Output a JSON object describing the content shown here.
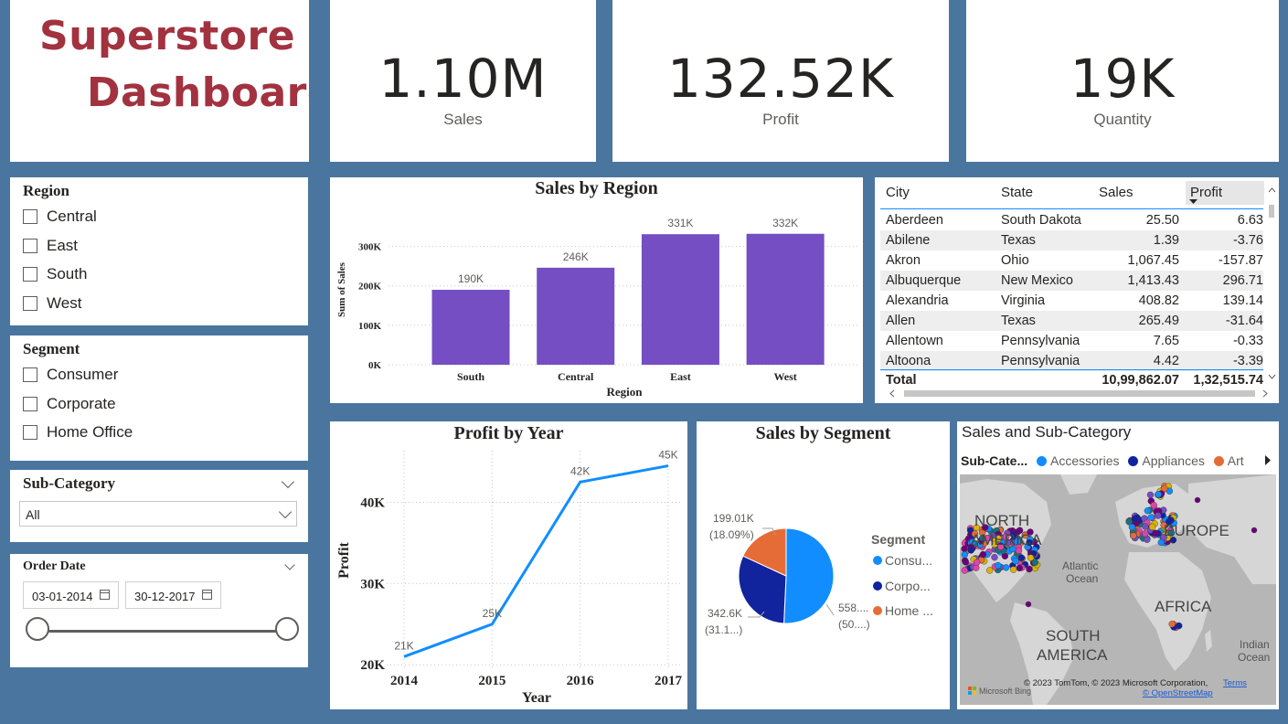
{
  "title": {
    "line1": "Superstore",
    "line2": "Dashboard"
  },
  "kpis": [
    {
      "value": "1.10M",
      "label": "Sales"
    },
    {
      "value": "132.52K",
      "label": "Profit"
    },
    {
      "value": "19K",
      "label": "Quantity"
    }
  ],
  "region_slicer": {
    "title": "Region",
    "items": [
      "Central",
      "East",
      "South",
      "West"
    ]
  },
  "segment_slicer": {
    "title": "Segment",
    "items": [
      "Consumer",
      "Corporate",
      "Home Office"
    ]
  },
  "subcategory_slicer": {
    "title": "Sub-Category",
    "selected": "All"
  },
  "order_date_slicer": {
    "title": "Order Date",
    "start": "03-01-2014",
    "end": "30-12-2017"
  },
  "sales_by_region": {
    "title": "Sales by Region",
    "xlabel": "Region",
    "ylabel": "Sum of Sales",
    "y_ticks": [
      "0K",
      "100K",
      "200K",
      "300K"
    ],
    "chart_data": {
      "type": "bar",
      "categories": [
        "South",
        "Central",
        "East",
        "West"
      ],
      "values": [
        190,
        246,
        331,
        332
      ],
      "data_labels": [
        "190K",
        "246K",
        "331K",
        "332K"
      ],
      "ylim": [
        0,
        350
      ],
      "color": "#744ec2"
    }
  },
  "table": {
    "headers": {
      "city": "City",
      "state": "State",
      "sales": "Sales",
      "profit": "Profit"
    },
    "rows": [
      {
        "city": "Aberdeen",
        "state": "South Dakota",
        "sales": "25.50",
        "profit": "6.63"
      },
      {
        "city": "Abilene",
        "state": "Texas",
        "sales": "1.39",
        "profit": "-3.76"
      },
      {
        "city": "Akron",
        "state": "Ohio",
        "sales": "1,067.45",
        "profit": "-157.87"
      },
      {
        "city": "Albuquerque",
        "state": "New Mexico",
        "sales": "1,413.43",
        "profit": "296.71"
      },
      {
        "city": "Alexandria",
        "state": "Virginia",
        "sales": "408.82",
        "profit": "139.14"
      },
      {
        "city": "Allen",
        "state": "Texas",
        "sales": "265.49",
        "profit": "-31.64"
      },
      {
        "city": "Allentown",
        "state": "Pennsylvania",
        "sales": "7.65",
        "profit": "-0.33"
      },
      {
        "city": "Altoona",
        "state": "Pennsylvania",
        "sales": "4.42",
        "profit": "-3.39"
      }
    ],
    "total": {
      "label": "Total",
      "sales": "10,99,862.07",
      "profit": "1,32,515.74"
    }
  },
  "profit_by_year": {
    "title": "Profit by Year",
    "xlabel": "Year",
    "ylabel": "Profit",
    "y_ticks": [
      "20K",
      "30K",
      "40K"
    ],
    "chart_data": {
      "type": "line",
      "x": [
        "2014",
        "2015",
        "2016",
        "2017"
      ],
      "values": [
        21,
        25,
        42.5,
        44.5
      ],
      "data_labels": [
        "21K",
        "25K",
        "42K",
        "45K"
      ],
      "ylim": [
        19.8,
        46.7
      ],
      "color": "#118dff"
    }
  },
  "sales_by_segment": {
    "title": "Sales by Segment",
    "legend_title": "Segment",
    "legend": [
      "Consu...",
      "Corpo...",
      "Home ..."
    ],
    "chart_data": {
      "type": "pie",
      "labels": [
        "Consumer",
        "Corporate",
        "Home Office"
      ],
      "values": [
        558,
        342.6,
        199.01
      ],
      "percents": [
        50.76,
        31.15,
        18.09
      ],
      "data_labels": [
        {
          "value": "558....",
          "pct": "(50....)"
        },
        {
          "value": "342.6K",
          "pct": "(31.1...)"
        },
        {
          "value": "199.01K",
          "pct": "(18.09%)"
        }
      ],
      "colors": [
        "#118dff",
        "#12239e",
        "#e66c37"
      ]
    }
  },
  "map": {
    "title": "Sales and Sub-Category",
    "legend_title": "Sub-Cate...",
    "legend": [
      {
        "name": "Accessories",
        "color": "#118dff"
      },
      {
        "name": "Appliances",
        "color": "#12239e"
      },
      {
        "name": "Art",
        "color": "#e66c37"
      }
    ],
    "labels": {
      "north": "NORTH",
      "america": "AMERICA",
      "europe": "EUROPE",
      "africa": "AFRICA",
      "south": "SOUTH",
      "south_america": "AMERICA",
      "atlantic": "Atlantic",
      "ocean": "Ocean",
      "indian": "Indian",
      "indian_ocean": "Ocean"
    },
    "attribution": "© 2023 TomTom, © 2023 Microsoft Corporation,",
    "terms": "Terms",
    "osm": "© OpenStreetMap",
    "bing": "Microsoft Bing"
  }
}
